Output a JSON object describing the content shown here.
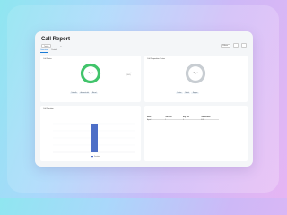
{
  "page": {
    "title": "Call Report"
  },
  "toolbar": {
    "date_chip": "Today",
    "extra_chip": "v",
    "filter_label": "Filters"
  },
  "tabs": [
    "Overview",
    "Details"
  ],
  "call_status": {
    "title": "Call Status",
    "center_label": "Total",
    "center_value": "1",
    "legend_lines": [
      "Answered",
      "1 (100%)"
    ],
    "pills": [
      "Total calls",
      "Answered calls",
      "Missed"
    ],
    "accent": "#41c46b"
  },
  "call_disposition": {
    "title": "Call Disposition Status",
    "center_label": "Total",
    "center_value": "0",
    "pills": [
      "Positive",
      "Neutral",
      "Negative"
    ],
    "accent": "#c8cdd2"
  },
  "call_duration": {
    "title": "Call Duration",
    "legend": "Duration",
    "bar_color": "#4d6fc7"
  },
  "table": {
    "headers": [
      "Name",
      "Total calls",
      "Avg. time",
      "Total duration"
    ],
    "rows": [
      [
        "Agent 1",
        "1",
        "0",
        "0:01"
      ]
    ]
  },
  "chart_data": {
    "type": "bar",
    "title": "Call Duration",
    "categories": [
      ""
    ],
    "values": [
      1
    ],
    "ylim": [
      0,
      1
    ]
  }
}
